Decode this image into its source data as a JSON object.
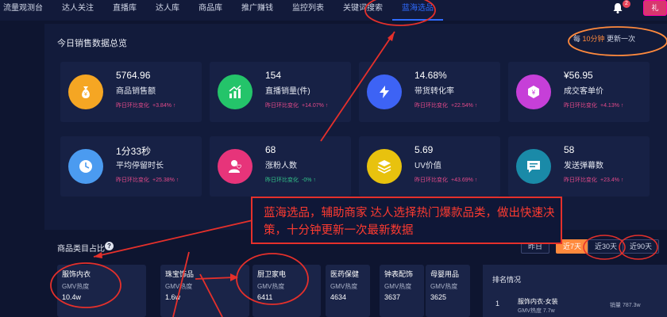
{
  "nav": {
    "items": [
      "流量观测台",
      "达人关注",
      "直播库",
      "达人库",
      "商品库",
      "推广赚钱",
      "监控列表",
      "关键词搜索",
      "蓝海选品"
    ],
    "active_index": 8,
    "bell_badge": "2",
    "gift_label": "礼"
  },
  "overview": {
    "title": "今日销售数据总览",
    "refresh_prefix": "每 ",
    "refresh_highlight": "10分钟",
    "refresh_suffix": " 更新一次",
    "change_label": "昨日环比变化",
    "cards": [
      {
        "value": "5764.96",
        "label": "商品销售额",
        "pct": "+3.84% ↑",
        "trend": "up",
        "icon": "money-bag-icon",
        "color": "#f5a623"
      },
      {
        "value": "154",
        "label": "直播销量(件)",
        "pct": "+14.07% ↑",
        "trend": "up",
        "icon": "chart-growth-icon",
        "color": "#24c46a"
      },
      {
        "value": "14.68%",
        "label": "带货转化率",
        "pct": "+22.54% ↑",
        "trend": "up",
        "icon": "conversion-icon",
        "color": "#3d63f5"
      },
      {
        "value": "¥56.95",
        "label": "成交客单价",
        "pct": "+4.13% ↑",
        "trend": "up",
        "icon": "yen-icon",
        "color": "#c63fd8"
      },
      {
        "value": "1分33秒",
        "label": "平均停留时长",
        "pct": "+25.38% ↑",
        "trend": "up",
        "icon": "clock-icon",
        "color": "#4b9bf0"
      },
      {
        "value": "68",
        "label": "涨粉人数",
        "pct": "-0% ↑",
        "trend": "flat",
        "icon": "user-heart-icon",
        "color": "#e7347a"
      },
      {
        "value": "5.69",
        "label": "UV价值",
        "pct": "+43.69% ↑",
        "trend": "up",
        "icon": "layers-icon",
        "color": "#e8c20e"
      },
      {
        "value": "58",
        "label": "发送弹幕数",
        "pct": "+23.4% ↑",
        "trend": "up",
        "icon": "message-icon",
        "color": "#1a8aa8"
      }
    ]
  },
  "annotation": {
    "text": "蓝海选品，辅助商家 达人选择热门爆款品类，做出快速决策，十分钟更新一次最新数据"
  },
  "category": {
    "title": "商品类目占比",
    "help": "?",
    "ranges": [
      "昨日",
      "近7天",
      "近30天",
      "近90天"
    ],
    "active_range": 1,
    "sub_label": "GMV热度",
    "tiles": [
      {
        "name": "服饰内衣",
        "value": "10.4w"
      },
      {
        "name": "珠宝饰品",
        "value": "1.6w"
      },
      {
        "name": "厨卫家电",
        "value": "6411"
      },
      {
        "name": "医药保健",
        "value": "4634"
      },
      {
        "name": "钟表配饰",
        "value": "3637"
      },
      {
        "name": "母婴用品",
        "value": "3625"
      }
    ]
  },
  "ranking": {
    "title": "排名情况",
    "rows": [
      {
        "rank": "1",
        "name": "服饰内衣-女装",
        "sub": "GMV热度 7.7w",
        "sales": "销量 787.3w"
      }
    ]
  }
}
